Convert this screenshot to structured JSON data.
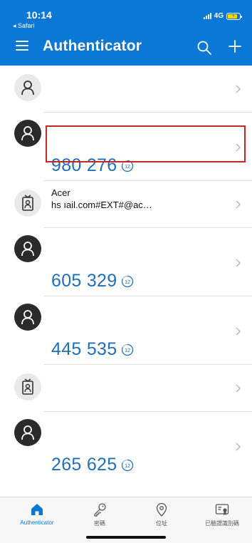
{
  "status_bar": {
    "time": "10:14",
    "back_label": "◂ Safari",
    "network": "4G"
  },
  "nav": {
    "title": "Authenticator",
    "hamburger_icon": "hamburger-menu-icon",
    "search_icon": "search-icon",
    "add_icon": "plus-icon"
  },
  "colors": {
    "accent": "#0a78d4",
    "code": "#1f6fba",
    "highlight_border": "#c62828"
  },
  "accounts": [
    {
      "name": "",
      "username": "",
      "code": "",
      "timer": "",
      "icon": "person-icon",
      "avatar_style": "light"
    },
    {
      "name": "",
      "username": "",
      "code": "980 276",
      "timer": "12",
      "icon": "person-icon",
      "avatar_style": "dark"
    },
    {
      "name": "Acer",
      "username": "hs                              ıail.com#EXT#@ac…",
      "code": "",
      "timer": "",
      "icon": "id-badge-icon",
      "avatar_style": "light"
    },
    {
      "name": "",
      "username": "",
      "code": "605 329",
      "timer": "12",
      "icon": "person-icon",
      "avatar_style": "dark"
    },
    {
      "name": "",
      "username": "",
      "code": "445 535",
      "timer": "12",
      "icon": "person-icon",
      "avatar_style": "dark"
    },
    {
      "name": "",
      "username": "",
      "code": "",
      "timer": "",
      "icon": "id-badge-icon",
      "avatar_style": "light"
    },
    {
      "name": "",
      "username": "",
      "code": "265 625",
      "timer": "12",
      "icon": "person-icon",
      "avatar_style": "dark"
    }
  ],
  "tabs": [
    {
      "label": "Authenticator",
      "icon": "home-icon",
      "active": true
    },
    {
      "label": "密碼",
      "icon": "key-icon",
      "active": false
    },
    {
      "label": "位址",
      "icon": "location-pin-icon",
      "active": false
    },
    {
      "label": "已驗證識別碼",
      "icon": "verified-id-card-icon",
      "active": false
    }
  ]
}
